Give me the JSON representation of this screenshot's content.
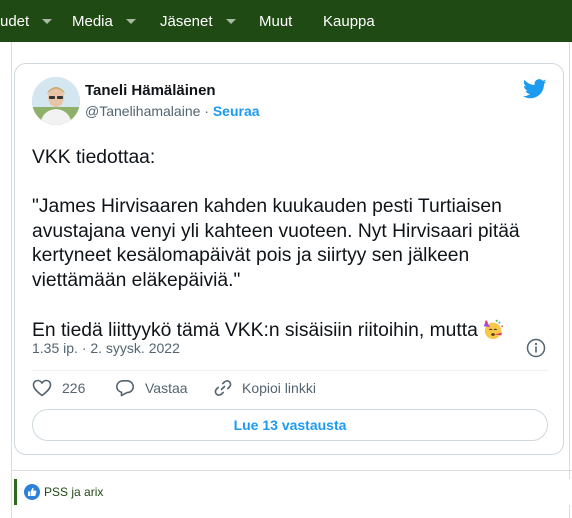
{
  "nav": {
    "items": [
      {
        "label": "udet",
        "dropdown": false
      },
      {
        "label": "Media",
        "dropdown": true
      },
      {
        "label": "Jäsenet",
        "dropdown": true
      },
      {
        "label": "Muut",
        "dropdown": false
      },
      {
        "label": "Kauppa",
        "dropdown": false
      }
    ]
  },
  "tweet": {
    "author_name": "Taneli Hämäläinen",
    "handle": "@Tanelihamalaine",
    "separator": " · ",
    "follow_label": "Seuraa",
    "paragraphs": [
      "VKK tiedottaa:",
      "\"James Hirvisaaren kahden kuukauden pesti Turtiaisen avustajana venyi yli kahteen vuoteen. Nyt Hirvisaari pitää kertyneet kesälomapäivät pois ja siirtyy sen jälkeen viettämään eläkepäiviä.\"",
      "En tiedä liittyykö tämä VKK:n sisäisiin riitoihin, mutta"
    ],
    "trailing_emoji": "party-face-icon",
    "timestamp": "1.35 ip. · 2. syysk. 2022",
    "like_count": "226",
    "reply_label": "Vastaa",
    "copy_link_label": "Kopioi linkki",
    "read_replies_label": "Lue 13 vastausta"
  },
  "reactions": {
    "names": "PSS ja arix"
  },
  "colors": {
    "nav_bg": "#1f4a14",
    "twitter_blue": "#1d9bf0",
    "text_primary": "#0f1419",
    "text_secondary": "#536471"
  }
}
